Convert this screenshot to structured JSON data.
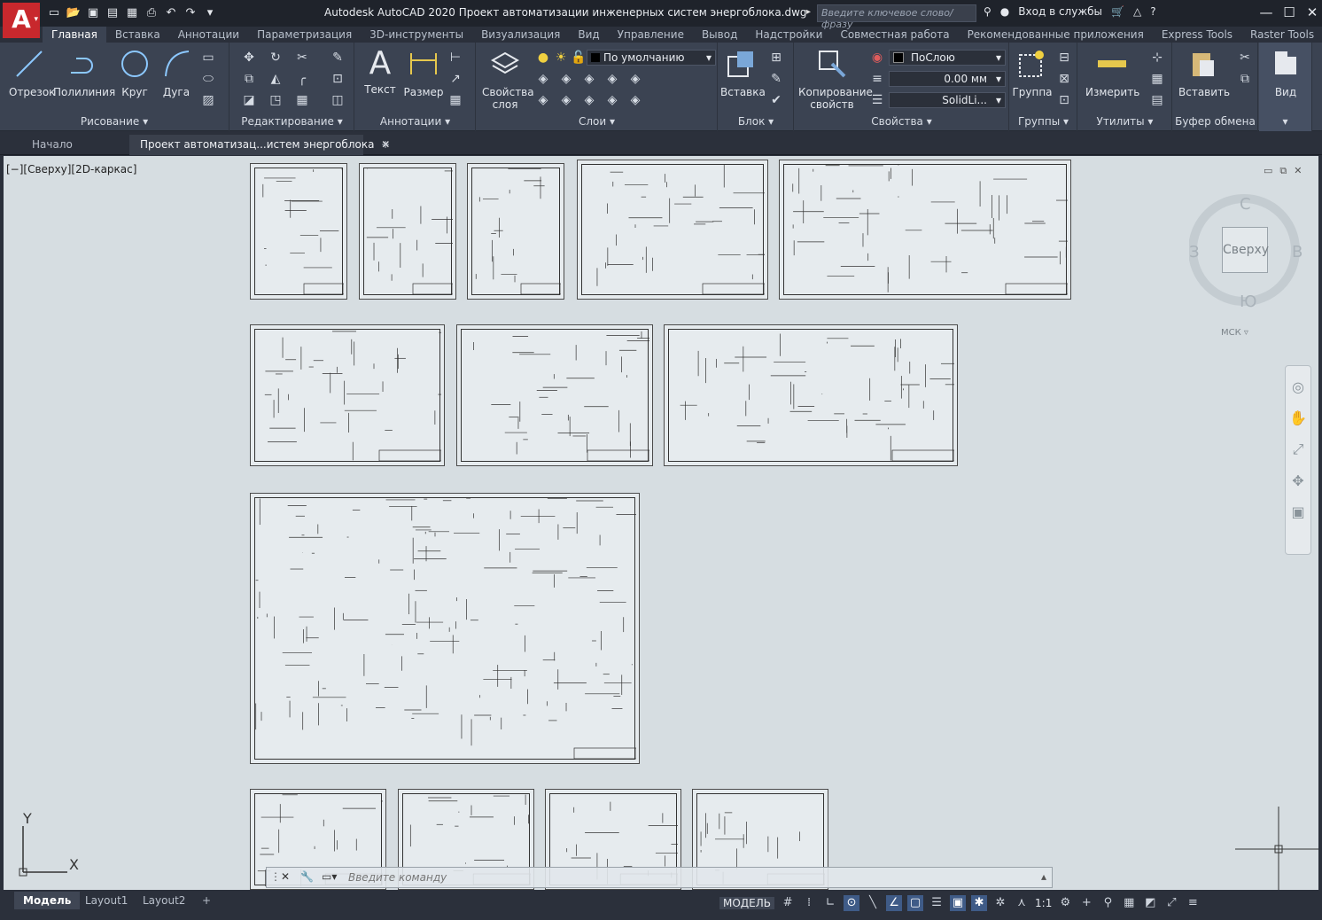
{
  "app": {
    "title": "Autodesk AutoCAD 2020   Проект автоматизации инженерных систем энергоблока.dwg",
    "search_placeholder": "Введите ключевое слово/фразу",
    "sign_in": "Вход в службы",
    "logo_letter": "A"
  },
  "tabs": [
    "Главная",
    "Вставка",
    "Аннотации",
    "Параметризация",
    "3D-инструменты",
    "Визуализация",
    "Вид",
    "Управление",
    "Вывод",
    "Надстройки",
    "Совместная работа",
    "Рекомендованные приложения",
    "Express Tools",
    "Raster Tools"
  ],
  "ribbon": {
    "draw": {
      "title": "Рисование",
      "line": "Отрезок",
      "polyline": "Полилиния",
      "circle": "Круг",
      "arc": "Дуга"
    },
    "modify": {
      "title": "Редактирование"
    },
    "annotation": {
      "title": "Аннотации",
      "text": "Текст",
      "dimension": "Размер"
    },
    "layers": {
      "title": "Слои",
      "properties": "Свойства слоя",
      "current_layer": "По умолчанию"
    },
    "block": {
      "title": "Блок",
      "insert": "Вставка"
    },
    "properties": {
      "title": "Свойства",
      "match": "Копирование свойств",
      "color": "ПоСлою",
      "lineweight": "0.00 мм",
      "linetype": "SolidLi..."
    },
    "groups": {
      "title": "Группы",
      "group": "Группа"
    },
    "utilities": {
      "title": "Утилиты",
      "measure": "Измерить"
    },
    "clipboard": {
      "title": "Буфер обмена",
      "paste": "Вставить"
    },
    "view": {
      "title": "Вид"
    }
  },
  "doc_tabs": {
    "start": "Начало",
    "current": "Проект автоматизац...истем энергоблока"
  },
  "viewport": {
    "label": "[−][Сверху][2D-каркас]",
    "viewcube": {
      "north": "С",
      "south": "Ю",
      "west": "З",
      "east": "В",
      "face": "Сверху",
      "ucs": "МСК"
    },
    "axis_x": "X",
    "axis_y": "Y"
  },
  "command_line": {
    "placeholder": "Введите команду"
  },
  "status": {
    "layouts": [
      "Модель",
      "Layout1",
      "Layout2"
    ],
    "model_label": "МОДЕЛЬ",
    "scale": "1:1"
  },
  "colors": {
    "accent": "#c8282d",
    "ribbon_bg": "#3b4352",
    "viewport_bg": "#d6dde1"
  }
}
